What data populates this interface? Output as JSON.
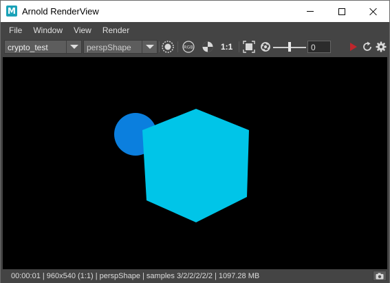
{
  "window": {
    "icon_letter": "M",
    "title": "Arnold RenderView"
  },
  "menu": {
    "items": [
      {
        "label": "File"
      },
      {
        "label": "Window"
      },
      {
        "label": "View"
      },
      {
        "label": "Render"
      }
    ]
  },
  "toolbar": {
    "camera_select": {
      "value": "crypto_test"
    },
    "shape_select": {
      "value": "perspShape"
    },
    "ratio_label": "1:1",
    "exposure": {
      "value": "0",
      "slider_level": 0.5
    },
    "rgb_label": "RGB",
    "icons": [
      "aov-circle-icon",
      "rgb-channel-icon",
      "alpha-icon",
      "crop-region-icon",
      "exposure-icon",
      "render-play-icon",
      "refresh-icon",
      "settings-gear-icon"
    ],
    "colors": {
      "play": "#c0262c",
      "icon": "#d8d8d8"
    }
  },
  "viewport": {
    "background": "#000000",
    "sphere_color": "#0b7fde",
    "cube_color": "#00c5e8"
  },
  "status": {
    "text": "00:00:01 | 960x540 (1:1) | perspShape  | samples 3/2/2/2/2/2 | 1097.28 MB"
  }
}
